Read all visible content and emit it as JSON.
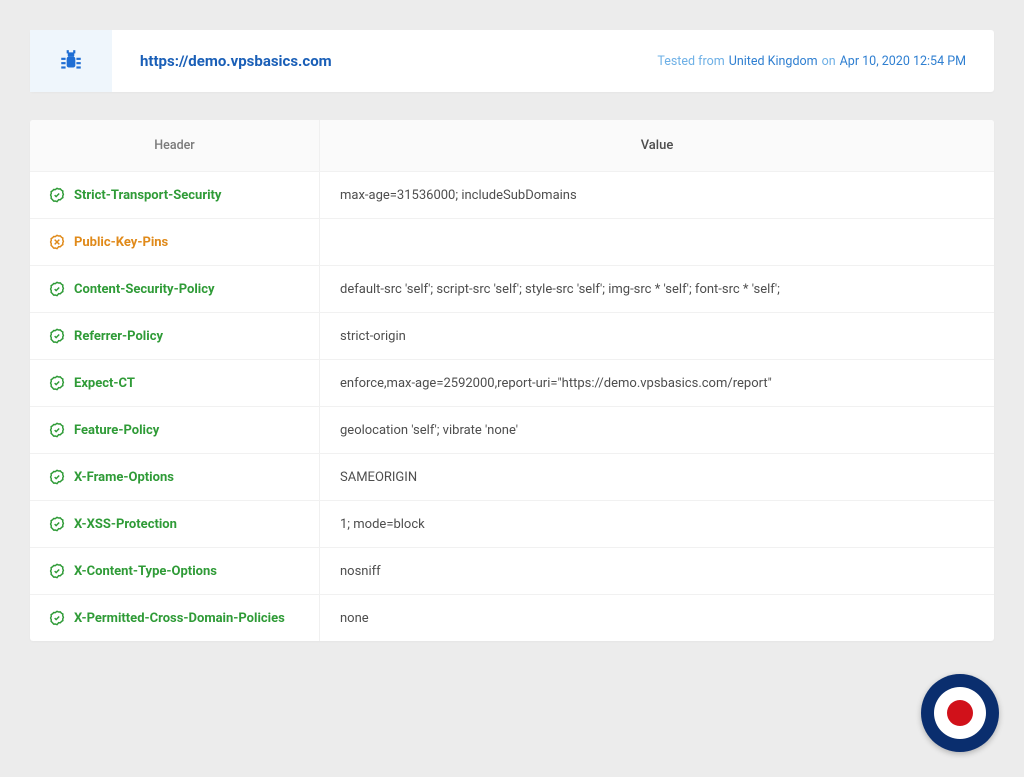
{
  "summary": {
    "url": "https://demo.vpsbasics.com",
    "meta_prefix": "Tested from",
    "region": "United Kingdom",
    "meta_on": "on",
    "timestamp": "Apr 10, 2020 12:54 PM"
  },
  "table": {
    "col_header": "Header",
    "col_value": "Value",
    "rows": [
      {
        "status": "ok",
        "name": "Strict-Transport-Security",
        "value": "max-age=31536000; includeSubDomains"
      },
      {
        "status": "warn",
        "name": "Public-Key-Pins",
        "value": ""
      },
      {
        "status": "ok",
        "name": "Content-Security-Policy",
        "value": "default-src 'self'; script-src 'self'; style-src 'self'; img-src * 'self'; font-src * 'self';"
      },
      {
        "status": "ok",
        "name": "Referrer-Policy",
        "value": "strict-origin"
      },
      {
        "status": "ok",
        "name": "Expect-CT",
        "value": "enforce,max-age=2592000,report-uri=\"https://demo.vpsbasics.com/report\""
      },
      {
        "status": "ok",
        "name": "Feature-Policy",
        "value": "geolocation 'self'; vibrate 'none'"
      },
      {
        "status": "ok",
        "name": "X-Frame-Options",
        "value": "SAMEORIGIN"
      },
      {
        "status": "ok",
        "name": "X-XSS-Protection",
        "value": "1; mode=block"
      },
      {
        "status": "ok",
        "name": "X-Content-Type-Options",
        "value": "nosniff"
      },
      {
        "status": "ok",
        "name": "X-Permitted-Cross-Domain-Policies",
        "value": "none"
      }
    ]
  }
}
